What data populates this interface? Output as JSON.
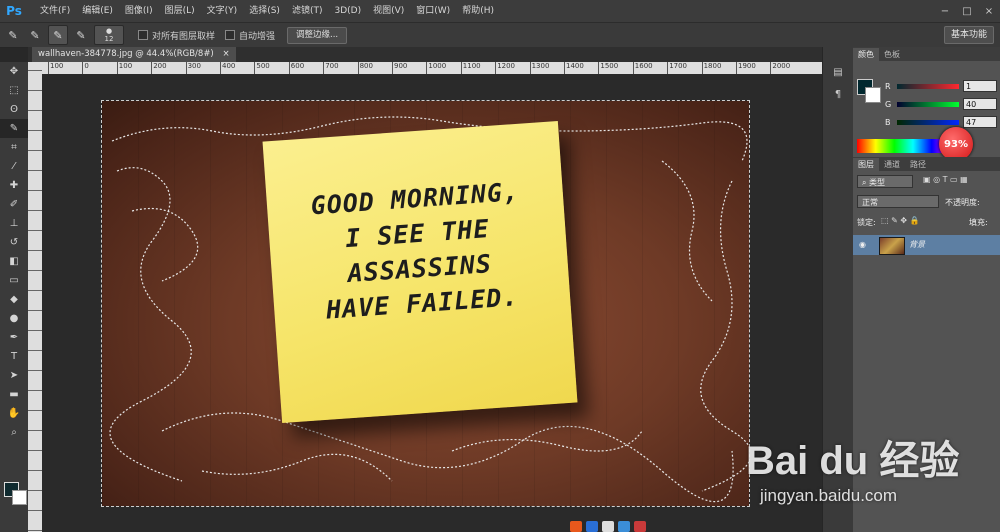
{
  "app": {
    "logo": "Ps"
  },
  "menu": [
    "文件(F)",
    "编辑(E)",
    "图像(I)",
    "图层(L)",
    "文字(Y)",
    "选择(S)",
    "滤镜(T)",
    "3D(D)",
    "视图(V)",
    "窗口(W)",
    "帮助(H)"
  ],
  "window_controls": [
    "−",
    "□",
    "×"
  ],
  "options": {
    "brush_size": "12",
    "sample_all_layers": "对所有图层取样",
    "auto_enhance": "自动增强",
    "refine_edge": "调整边缘...",
    "workspace": "基本功能"
  },
  "document": {
    "tab_title": "wallhaven-384778.jpg @ 44.4%(RGB/8#)",
    "tab_close": "×",
    "note_lines": [
      "GOOD MORNING,",
      "I SEE THE",
      "ASSASSINS",
      "HAVE FAILED."
    ]
  },
  "ruler": {
    "h_ticks": [
      "100",
      "0",
      "100",
      "200",
      "300",
      "400",
      "500",
      "600",
      "700",
      "800",
      "900",
      "1000",
      "1100",
      "1200",
      "1300",
      "1400",
      "1500",
      "1600",
      "1700",
      "1800",
      "1900",
      "2000"
    ]
  },
  "color_panel": {
    "tabs": [
      "颜色",
      "色板"
    ],
    "r_label": "R",
    "g_label": "G",
    "b_label": "B",
    "r": "1",
    "g": "40",
    "b": "47",
    "badge": "93%",
    "fg_color": "#01282f"
  },
  "layers_panel": {
    "tabs": [
      "图层",
      "通道",
      "路径"
    ],
    "filter_label": "类型",
    "blend_mode": "正常",
    "opacity_label": "不透明度:",
    "lock_label": "锁定:",
    "fill_label": "填充:",
    "layer_name": "背景"
  },
  "watermark": {
    "logo": "Bai du 经验",
    "url": "jingyan.baidu.com"
  }
}
